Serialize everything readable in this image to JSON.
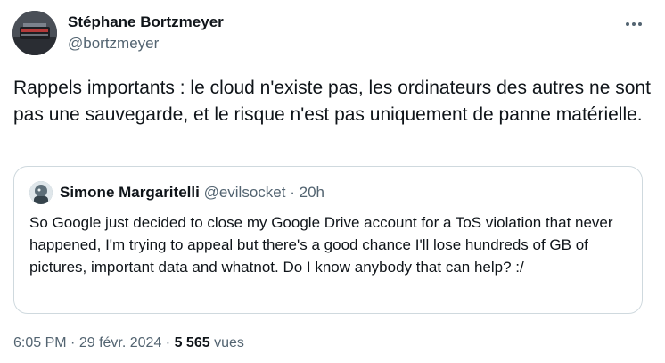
{
  "tweet": {
    "author": {
      "name": "Stéphane Bortzmeyer",
      "handle": "@bortzmeyer"
    },
    "text": "Rappels importants : le cloud n'existe pas, les ordinateurs des autres ne sont pas une sauvegarde, et le risque n'est pas uniquement de panne matérielle.",
    "more_icon": "more-horizontal-icon"
  },
  "quote": {
    "author": {
      "name": "Simone Margaritelli",
      "handle": "@evilsocket",
      "separator": "·",
      "time": "20h"
    },
    "text": "So Google just decided to close my Google Drive account for a ToS violation that never happened, I'm trying to appeal but there's a good chance I'll lose hundreds of GB of pictures, important data and whatnot. Do I know anybody that can help? :/"
  },
  "footer": {
    "time": "6:05 PM",
    "separator": "·",
    "date": "29 févr. 2024",
    "views_count": "5 565",
    "views_label": "vues"
  },
  "colors": {
    "text_primary": "#0f1419",
    "text_secondary": "#536471",
    "border": "#cfd9de",
    "background": "#ffffff"
  }
}
